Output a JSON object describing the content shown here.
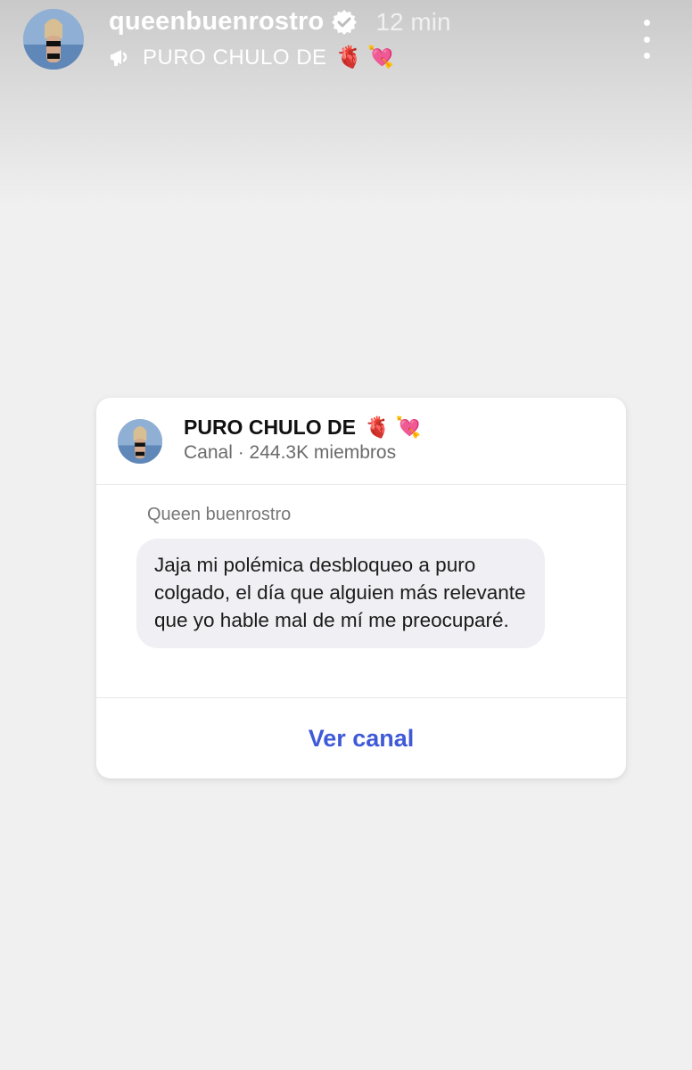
{
  "story": {
    "username": "queenbuenrostro",
    "time": "12 min",
    "subtitle": "PURO CHULO DE",
    "subtitle_emojis": [
      "🫀",
      "💘"
    ]
  },
  "card": {
    "channel_name": "PURO CHULO DE",
    "channel_emojis": [
      "🫀",
      "💘"
    ],
    "channel_meta": "Canal · 244.3K miembros",
    "sender": "Queen buenrostro",
    "message": "Jaja mi polémica desbloqueo a puro colgado, el día que alguien más relevante que yo hable mal de mí me preocuparé.",
    "action_label": "Ver canal"
  },
  "colors": {
    "accent": "#3f5ad8",
    "bubble": "#f0f0f4"
  },
  "icons": [
    "verified-badge-icon",
    "channel-icon",
    "more-options-icon"
  ]
}
